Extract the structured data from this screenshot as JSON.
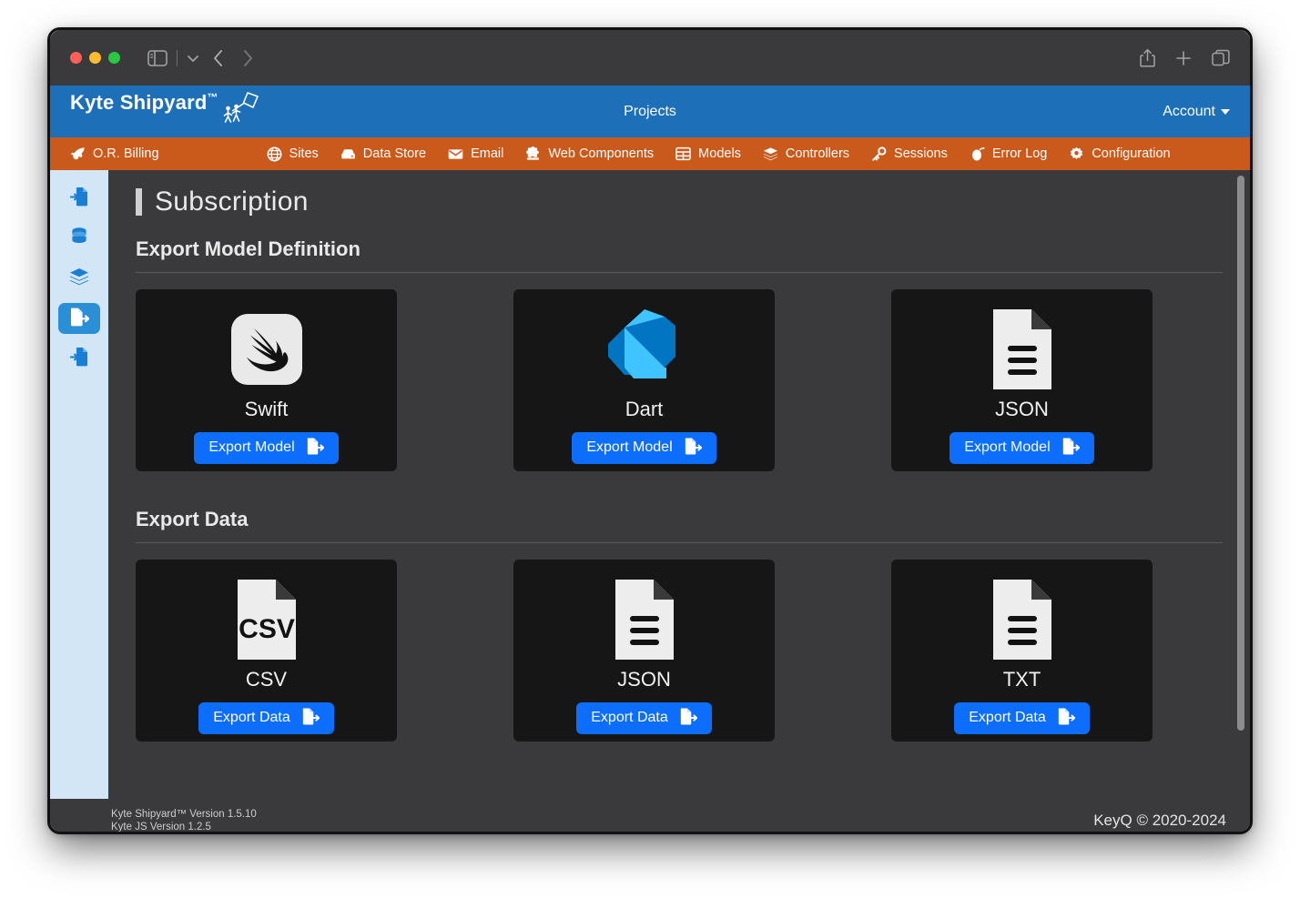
{
  "browser": {
    "controls": [
      "close",
      "minimize",
      "maximize"
    ],
    "sidebar_toggle_icon": "sidebar-icon",
    "dropdown_icon": "chevron-down-icon",
    "back_icon": "chevron-left-icon",
    "forward_icon": "chevron-right-icon",
    "share_icon": "share-icon",
    "newtab_icon": "plus-icon",
    "tabs_icon": "tab-overview-icon"
  },
  "header": {
    "brand": "Kyte Shipyard",
    "brand_tm": "™",
    "center_title": "Projects",
    "account_label": "Account",
    "bg_color": "#1d6fb8"
  },
  "nav": {
    "bg_color": "#ca5a1c",
    "items": [
      {
        "label": "O.R. Billing",
        "icon": "rocket-icon"
      },
      {
        "label": "Sites",
        "icon": "globe-icon"
      },
      {
        "label": "Data Store",
        "icon": "database-drive-icon"
      },
      {
        "label": "Email",
        "icon": "envelope-icon"
      },
      {
        "label": "Web Components",
        "icon": "puzzle-icon"
      },
      {
        "label": "Models",
        "icon": "table-icon"
      },
      {
        "label": "Controllers",
        "icon": "layers-icon"
      },
      {
        "label": "Sessions",
        "icon": "key-icon"
      },
      {
        "label": "Error Log",
        "icon": "bug-icon"
      },
      {
        "label": "Configuration",
        "icon": "gear-icon"
      }
    ]
  },
  "leftbar": {
    "bg_color": "#d3e6f5",
    "active_color": "#2b8fd6",
    "items": [
      {
        "icon": "file-import-icon",
        "active": false
      },
      {
        "icon": "database-icon",
        "active": false
      },
      {
        "icon": "layers-icon",
        "active": false
      },
      {
        "icon": "file-export-icon",
        "active": true
      },
      {
        "icon": "file-import-icon",
        "active": false
      }
    ]
  },
  "page": {
    "title": "Subscription",
    "sections": [
      {
        "heading": "Export Model Definition",
        "cards": [
          {
            "label": "Swift",
            "logo": "swift-logo",
            "button": "Export Model",
            "button_icon": "file-export-icon"
          },
          {
            "label": "Dart",
            "logo": "dart-logo",
            "button": "Export Model",
            "button_icon": "file-export-icon"
          },
          {
            "label": "JSON",
            "logo": "json-file-icon",
            "button": "Export Model",
            "button_icon": "file-export-icon"
          }
        ]
      },
      {
        "heading": "Export Data",
        "cards": [
          {
            "label": "CSV",
            "logo": "csv-file-icon",
            "button": "Export Data",
            "button_icon": "file-export-icon"
          },
          {
            "label": "JSON",
            "logo": "json-file-icon",
            "button": "Export Data",
            "button_icon": "file-export-icon"
          },
          {
            "label": "TXT",
            "logo": "txt-file-icon",
            "button": "Export Data",
            "button_icon": "file-export-icon"
          }
        ]
      }
    ]
  },
  "footer": {
    "version_line1": "Kyte Shipyard™ Version 1.5.10",
    "version_line2": "Kyte JS Version 1.2.5",
    "copyright": "KeyQ © 2020-2024"
  },
  "colors": {
    "accent_blue": "#0d6efd",
    "header_blue": "#1d6fb8",
    "nav_orange": "#ca5a1c",
    "card_bg": "#161617",
    "app_bg": "#3a3a3c"
  }
}
